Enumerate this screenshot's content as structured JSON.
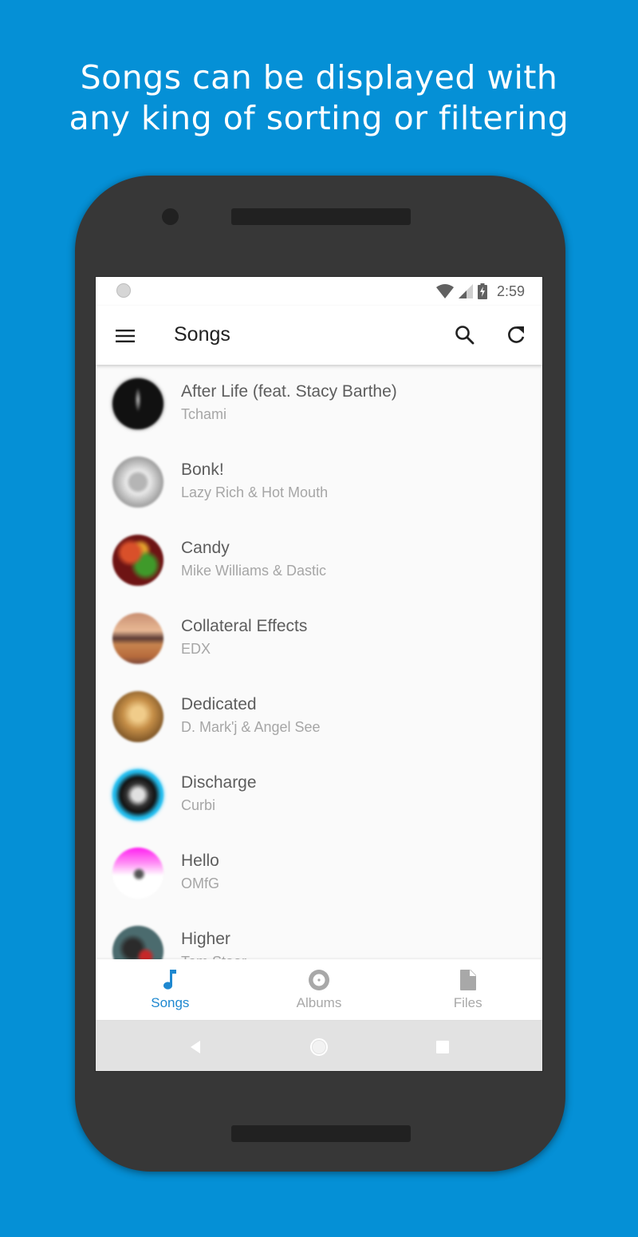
{
  "headline": {
    "line1": "Songs can be displayed with",
    "line2": "any king of sorting or filtering"
  },
  "colors": {
    "background": "#0590d6",
    "accent": "#1e88d0",
    "inactive": "#a8a8a8"
  },
  "statusbar": {
    "time": "2:59",
    "icons": [
      "notification-dot-icon",
      "wifi-icon",
      "signal-icon",
      "battery-charging-icon"
    ]
  },
  "appbar": {
    "title": "Songs",
    "menu_icon": "hamburger-menu-icon",
    "actions": [
      "search-icon",
      "refresh-icon"
    ]
  },
  "songs": [
    {
      "title": "After Life (feat. Stacy Barthe)",
      "artist": "Tchami"
    },
    {
      "title": "Bonk!",
      "artist": "Lazy Rich & Hot Mouth"
    },
    {
      "title": "Candy",
      "artist": "Mike Williams & Dastic"
    },
    {
      "title": "Collateral Effects",
      "artist": "EDX"
    },
    {
      "title": "Dedicated",
      "artist": "D. Mark'j & Angel See"
    },
    {
      "title": "Discharge",
      "artist": "Curbi"
    },
    {
      "title": "Hello",
      "artist": "OMfG"
    },
    {
      "title": "Higher",
      "artist": "Tom Staar"
    }
  ],
  "bottom_nav": {
    "tabs": [
      {
        "label": "Songs",
        "icon": "music-note-icon",
        "active": true
      },
      {
        "label": "Albums",
        "icon": "album-disc-icon",
        "active": false
      },
      {
        "label": "Files",
        "icon": "file-icon",
        "active": false
      }
    ]
  },
  "system_nav": [
    "back-icon",
    "home-icon",
    "recents-icon"
  ]
}
